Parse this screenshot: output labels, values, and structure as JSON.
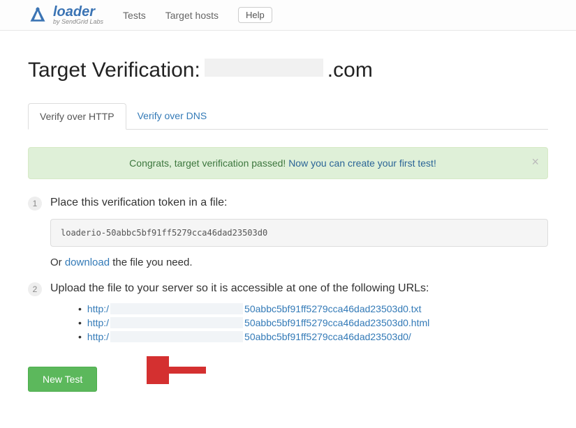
{
  "nav": {
    "brand_name": "loader",
    "brand_sub": "by SendGrid Labs",
    "tests": "Tests",
    "hosts": "Target hosts",
    "help": "Help"
  },
  "page": {
    "title_prefix": "Target Verification:",
    "title_suffix": ".com"
  },
  "tabs": {
    "http": "Verify over HTTP",
    "dns": "Verify over DNS"
  },
  "alert": {
    "text": "Congrats, target verification passed! ",
    "link": "Now you can create your first test!"
  },
  "steps": {
    "s1": "Place this verification token in a file:",
    "token": "loaderio-50abbc5bf91ff5279cca46dad23503d0",
    "s1_or": "Or ",
    "s1_download": "download",
    "s1_after": " the file you need.",
    "s2": "Upload the file to your server so it is accessible at one of the following URLs:",
    "url_prefix": "http:/",
    "urls": [
      "50abbc5bf91ff5279cca46dad23503d0.txt",
      "50abbc5bf91ff5279cca46dad23503d0.html",
      "50abbc5bf91ff5279cca46dad23503d0/"
    ]
  },
  "button": {
    "new_test": "New Test"
  }
}
